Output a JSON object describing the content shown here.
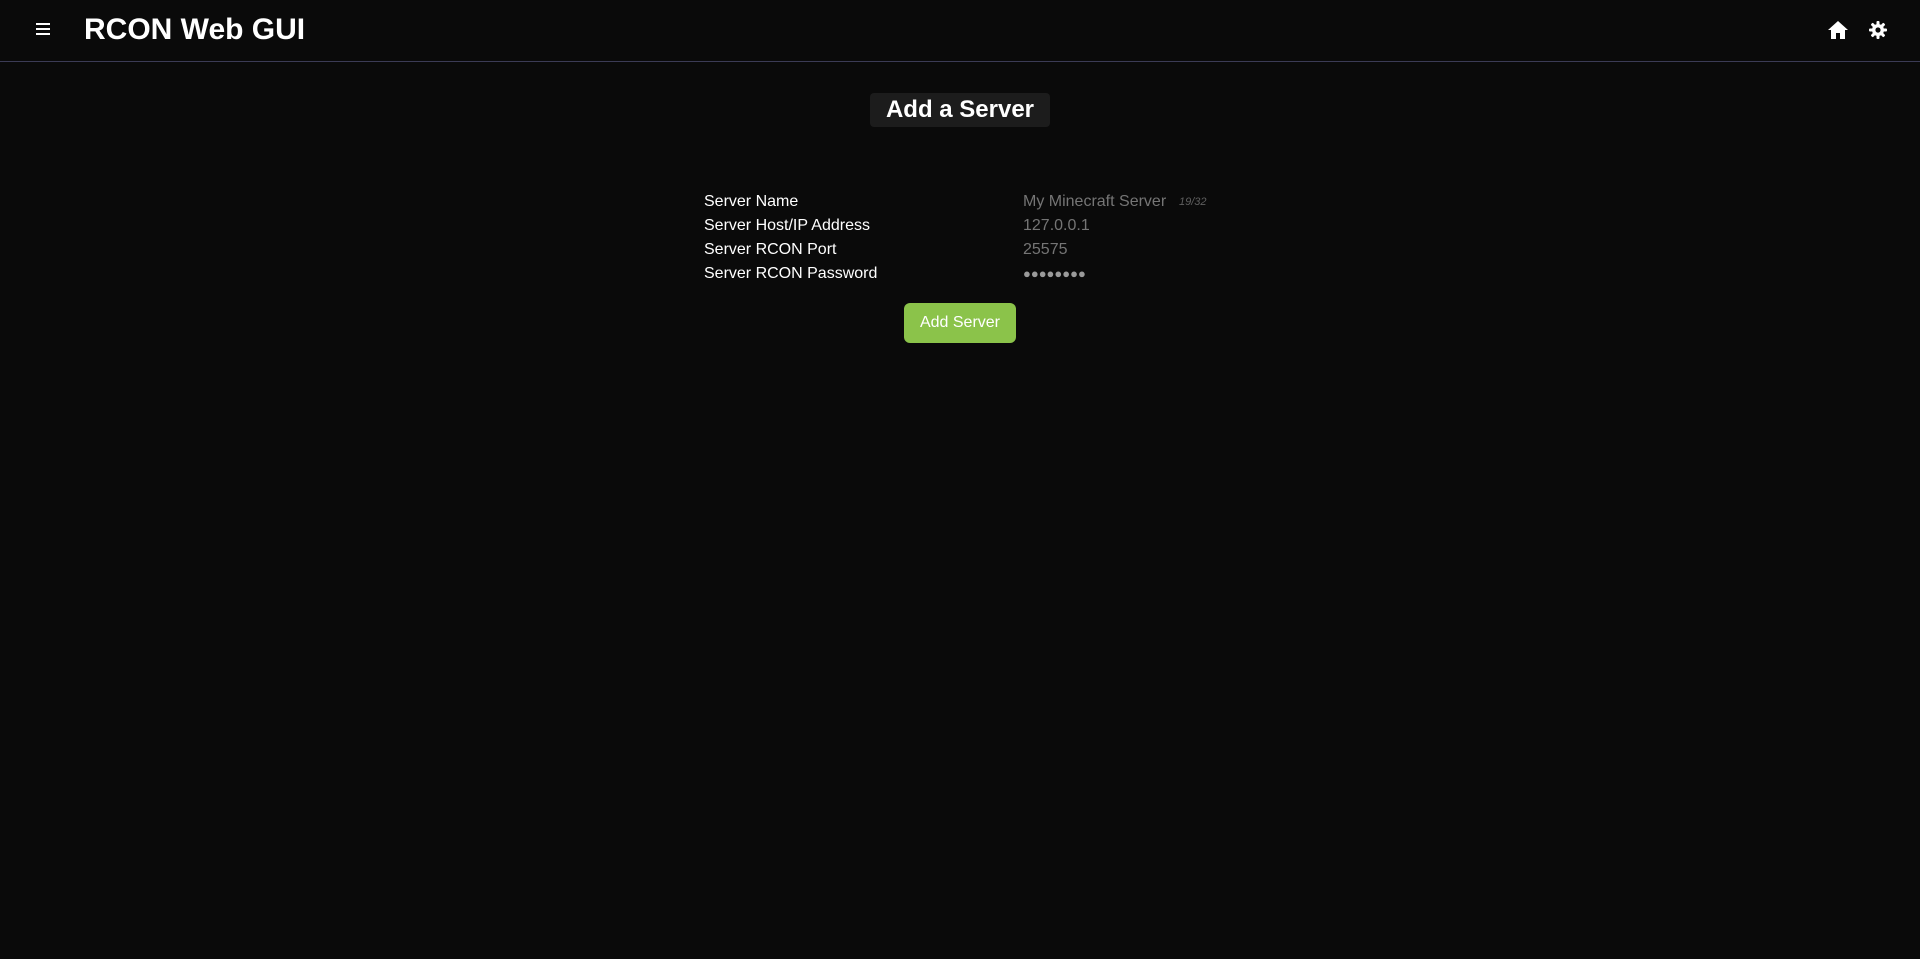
{
  "header": {
    "title": "RCON Web GUI",
    "menu_icon": "hamburger-menu-icon",
    "home_icon": "home-icon",
    "settings_icon": "gear-icon"
  },
  "page": {
    "title": "Add a Server"
  },
  "form": {
    "server_name": {
      "label": "Server Name",
      "placeholder": "My Minecraft Server",
      "counter": "19/32"
    },
    "host": {
      "label": "Server Host/IP Address",
      "placeholder": "127.0.0.1"
    },
    "port": {
      "label": "Server RCON Port",
      "placeholder": "25575"
    },
    "password": {
      "label": "Server RCON Password",
      "masked_value": "●●●●●●●●"
    },
    "submit_label": "Add Server"
  },
  "colors": {
    "background": "#0a0a0a",
    "accent": "#8bc34a",
    "header_border": "#3b3b55",
    "muted_text": "#9a9a9a"
  }
}
